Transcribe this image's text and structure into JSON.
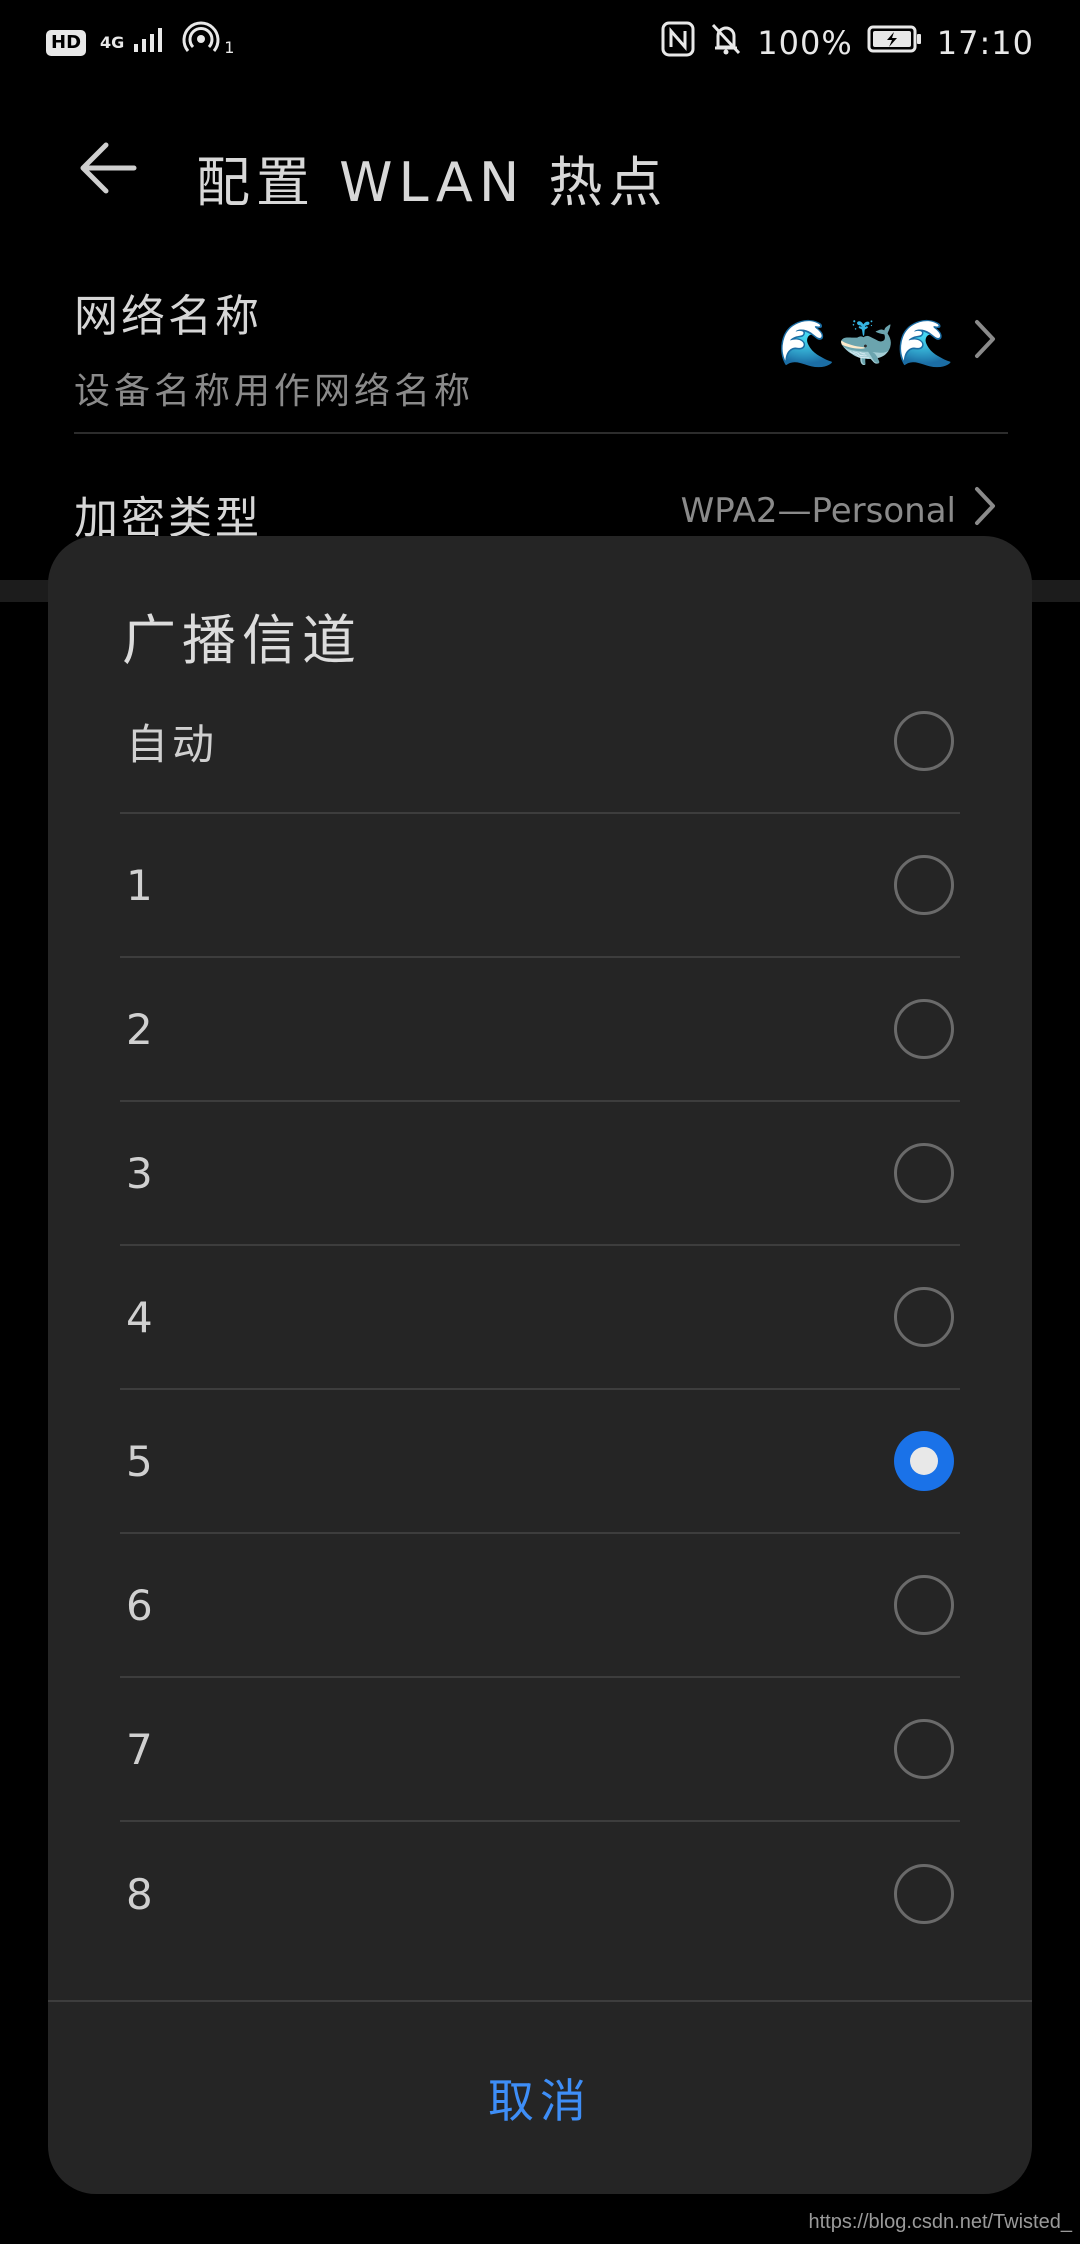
{
  "status_bar": {
    "hd": "HD",
    "network_type": "4G",
    "hotspot_count": "1",
    "battery": "100%",
    "time": "17:10"
  },
  "header": {
    "title": "配置 WLAN 热点"
  },
  "settings": {
    "network_name": {
      "title": "网络名称",
      "subtitle": "设备名称用作网络名称",
      "value": "🌊🐳🌊"
    },
    "encryption": {
      "title": "加密类型",
      "value": "WPA2—Personal"
    }
  },
  "dialog": {
    "title": "广播信道",
    "options": [
      {
        "label": "自动",
        "checked": false
      },
      {
        "label": "1",
        "checked": false
      },
      {
        "label": "2",
        "checked": false
      },
      {
        "label": "3",
        "checked": false
      },
      {
        "label": "4",
        "checked": false
      },
      {
        "label": "5",
        "checked": true
      },
      {
        "label": "6",
        "checked": false
      },
      {
        "label": "7",
        "checked": false
      },
      {
        "label": "8",
        "checked": false
      }
    ],
    "cancel_label": "取消"
  },
  "colors": {
    "accent": "#1a72e8",
    "cancel_text": "#3e8ef7",
    "sheet_background": "#252525"
  },
  "watermark": "https://blog.csdn.net/Twisted_"
}
